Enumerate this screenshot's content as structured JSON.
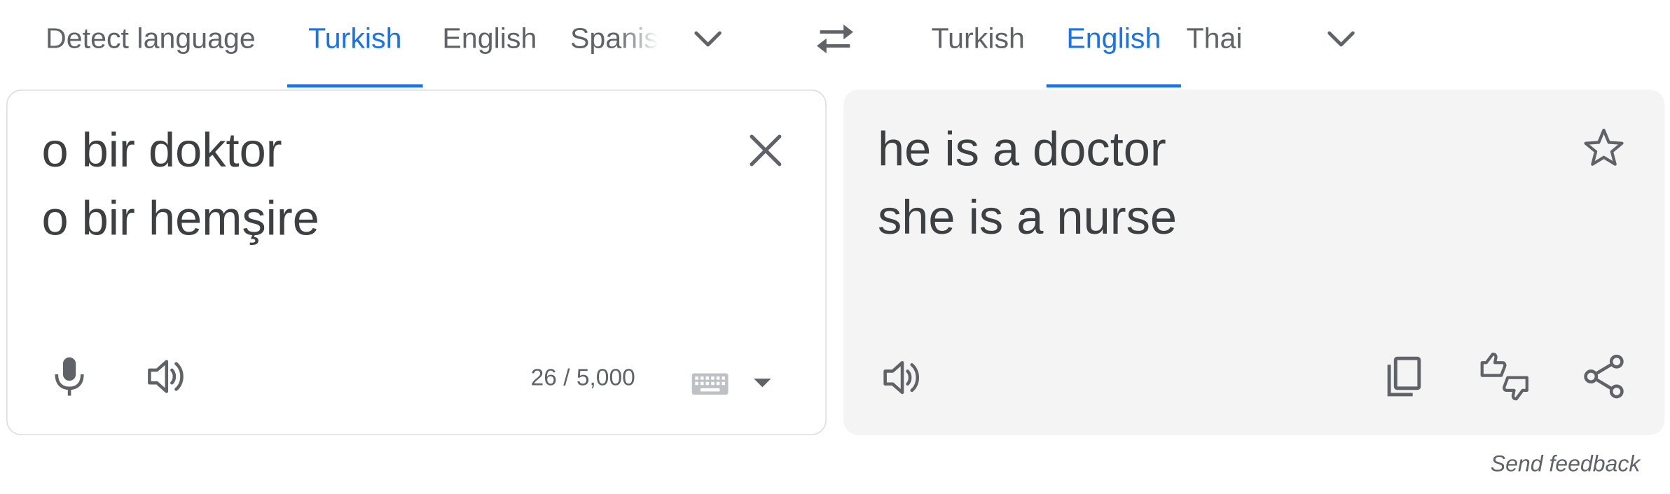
{
  "source_languages": {
    "tabs": [
      {
        "label": "Detect language",
        "active": false
      },
      {
        "label": "Turkish",
        "active": true
      },
      {
        "label": "English",
        "active": false
      },
      {
        "label": "Spanish",
        "active": false
      }
    ],
    "more_icon": "chevron-down-icon"
  },
  "swap_icon": "swap-arrows-icon",
  "target_languages": {
    "tabs": [
      {
        "label": "Turkish",
        "active": false
      },
      {
        "label": "English",
        "active": true
      },
      {
        "label": "Thai",
        "active": false
      }
    ],
    "more_icon": "chevron-down-icon"
  },
  "source_panel": {
    "lines": [
      "o bir doktor",
      "o bir hemşire"
    ],
    "char_count": "26 / 5,000",
    "icons": [
      "close-icon",
      "microphone-icon",
      "speaker-icon",
      "keyboard-icon",
      "dropdown-arrow-icon"
    ]
  },
  "target_panel": {
    "lines": [
      "he is a doctor",
      "she is a nurse"
    ],
    "icons": [
      "star-icon",
      "speaker-icon",
      "copy-icon",
      "rate-translation-icon",
      "share-icon"
    ]
  },
  "send_feedback": "Send feedback",
  "colors": {
    "accent": "#1a73e8",
    "text": "#3c4043",
    "muted": "#5f6368",
    "target_bg": "#f4f4f4",
    "border": "#dadce0"
  }
}
